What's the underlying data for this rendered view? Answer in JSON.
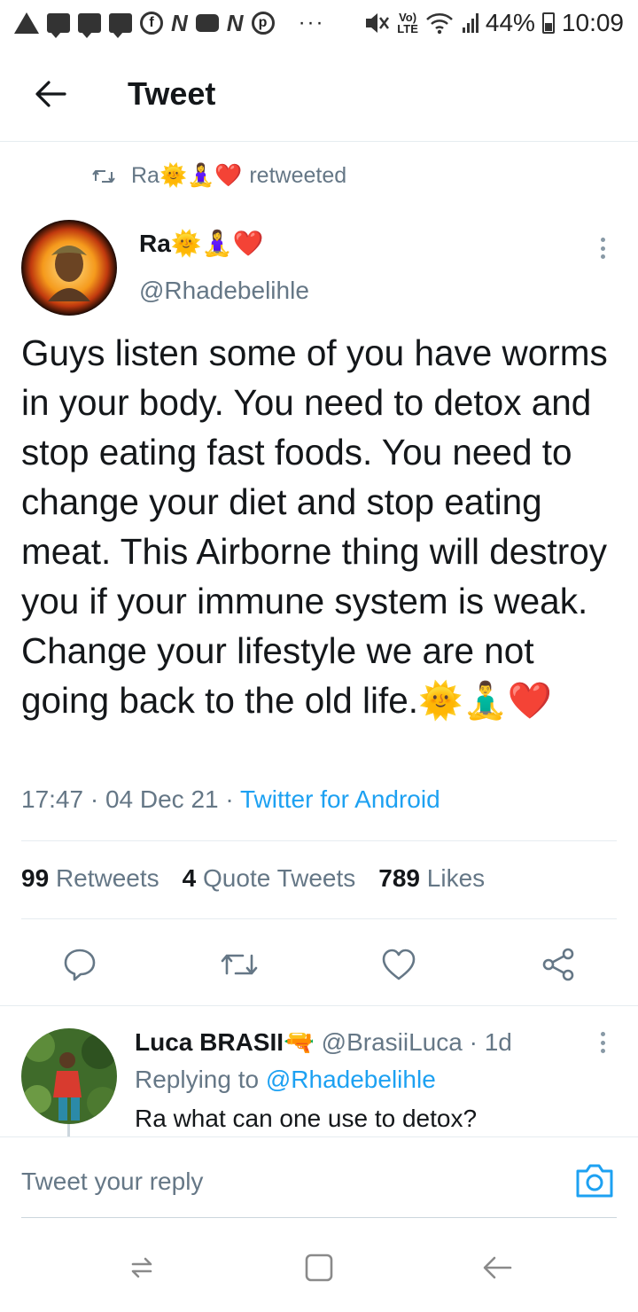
{
  "status_bar": {
    "dots": "···",
    "volte": "Vo)\nLTE",
    "battery_pct": "44%",
    "time": "10:09",
    "battery_level": 0.44
  },
  "header": {
    "title": "Tweet"
  },
  "retweet_context": {
    "name": "Ra🌞🧘‍♀️❤️",
    "label": "retweeted"
  },
  "tweet": {
    "author_name": "Ra🌞🧘‍♀️❤️",
    "author_handle": "@Rhadebelihle",
    "text": "Guys listen some of you have worms in your body. You need to detox and stop eating fast foods. You need to change your diet and stop eating meat. This Airborne thing will destroy you if your immune system is weak. Change your lifestyle we are not going back to the old life.🌞🧘‍♂️❤️",
    "time": "17:47",
    "sep1": " · ",
    "date": "04 Dec 21",
    "sep2": " · ",
    "source": "Twitter for Android"
  },
  "stats": {
    "retweets_count": "99",
    "retweets_label": "Retweets",
    "quotes_count": "4",
    "quotes_label": "Quote Tweets",
    "likes_count": "789",
    "likes_label": "Likes"
  },
  "icons": {
    "back": "arrow-left-icon",
    "reply": "comment-icon",
    "retweet": "retweet-icon",
    "like": "heart-icon",
    "share": "share-icon",
    "camera": "camera-icon"
  },
  "reply": {
    "name": "Luca BRASII🔫",
    "handle": "@BrasiiLuca",
    "sep": " · ",
    "age": "1d",
    "replying_prefix": "Replying to ",
    "replying_handle": "@Rhadebelihle",
    "text": "Ra what can one use to detox?"
  },
  "compose": {
    "placeholder": "Tweet your reply"
  },
  "colors": {
    "accent": "#1da1f2",
    "muted": "#657786",
    "text": "#14171a",
    "divider": "#e6ecf0"
  }
}
